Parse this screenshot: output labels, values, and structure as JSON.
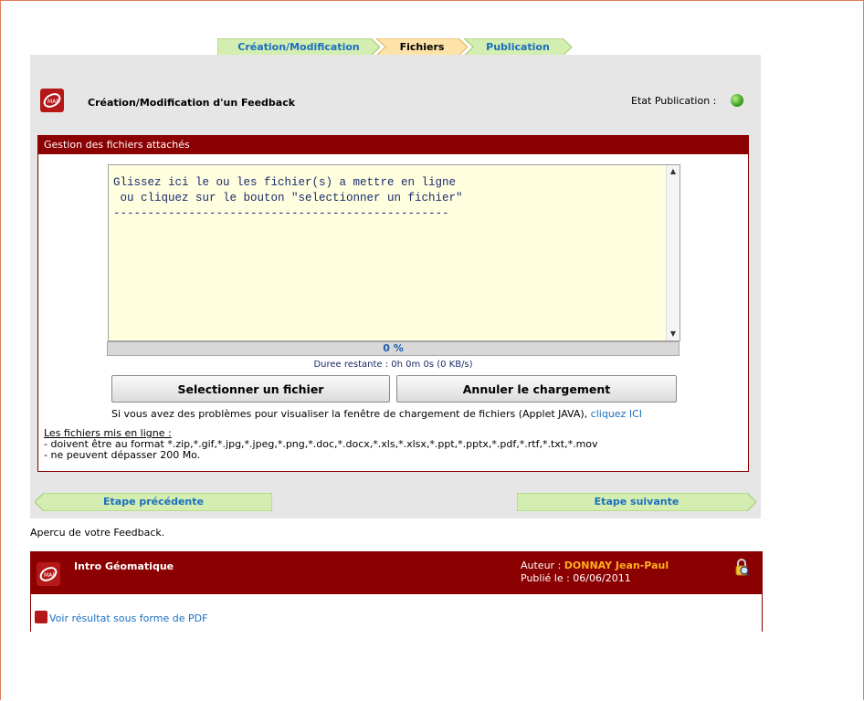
{
  "steps": {
    "creation": "Création/Modification",
    "fichiers": "Fichiers",
    "publication": "Publication"
  },
  "header": {
    "title": "Création/Modification d'un Feedback",
    "etat_label": "Etat Publication :",
    "status_color": "#3ca21e"
  },
  "upload": {
    "section_title": "Gestion des fichiers attachés",
    "drop_text": "Glissez ici le ou les fichier(s) a mettre en ligne\n ou cliquez sur le bouton \"selectionner un fichier\"\n-------------------------------------------------",
    "progress_label": "0 %",
    "progress_value": 0.0,
    "remaining": "Duree restante : 0h 0m 0s (0 KB/s)",
    "select_button": "Selectionner un fichier",
    "cancel_button": "Annuler le chargement",
    "note_text": "Si vous avez des problèmes pour visualiser la fenêtre de chargement de fichiers (Applet JAVA),",
    "note_link": "cliquez ICI",
    "files_heading": "Les fichiers mis en ligne :",
    "files_rule1": "- doivent être au format *.zip,*.gif,*.jpg,*.jpeg,*.png,*.doc,*.docx,*.xls,*.xlsx,*.ppt,*.pptx,*.pdf,*.rtf,*.txt,*.mov",
    "files_rule2": "- ne peuvent dépasser 200 Mo."
  },
  "nav": {
    "prev": "Etape précédente",
    "next": "Etape suivante"
  },
  "preview": {
    "label": "Apercu de votre Feedback.",
    "title": "Intro Géomatique",
    "author_label": "Auteur :",
    "author_name": "DONNAY Jean-Paul",
    "published": "Publié le : 06/06/2011",
    "pdf_link": "Voir résultat sous forme de PDF"
  },
  "colors": {
    "brand_red": "#8b0000",
    "step_green": "#d4edb0",
    "step_active": "#fde3a7",
    "link_blue": "#1a6fc0"
  }
}
